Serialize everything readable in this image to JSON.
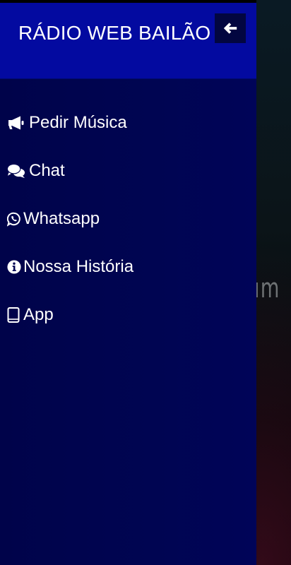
{
  "app": {
    "title": "RÁDIO WEB BAILÃO"
  },
  "background": {
    "partial_text": "um"
  },
  "drawer": {
    "close_icon": "arrow-left-icon",
    "items": [
      {
        "label": "Pedir Música",
        "icon": "megaphone-icon"
      },
      {
        "label": "Chat",
        "icon": "chat-bubbles-icon"
      },
      {
        "label": "Whatsapp",
        "icon": "whatsapp-icon"
      },
      {
        "label": "Nossa História",
        "icon": "info-circle-icon"
      },
      {
        "label": "App",
        "icon": "tablet-icon"
      }
    ]
  },
  "colors": {
    "header_bg": "#030aa0",
    "drawer_bg": "#000552",
    "text": "#ffffff"
  }
}
